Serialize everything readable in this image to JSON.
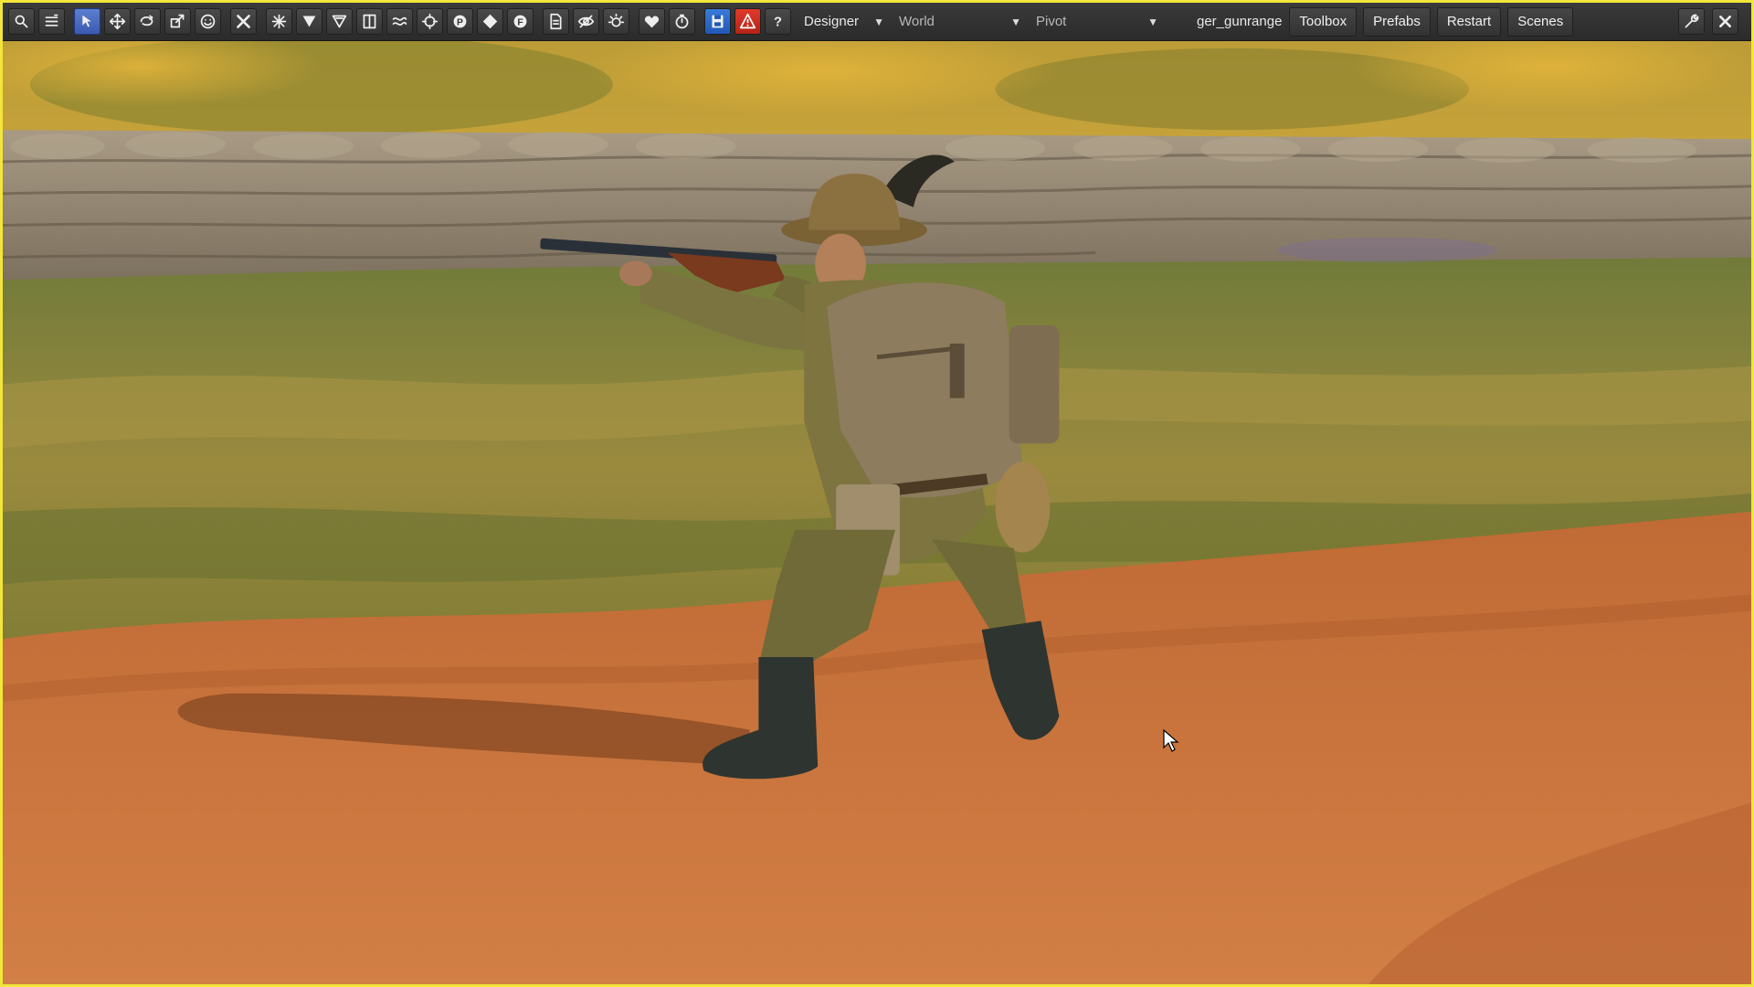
{
  "toolbar": {
    "left_icons": [
      {
        "name": "search-icon",
        "glyph": "search"
      },
      {
        "name": "menu-icon",
        "glyph": "menu"
      },
      {
        "name": "select-tool-icon",
        "glyph": "select",
        "active": true
      },
      {
        "name": "move-tool-icon",
        "glyph": "move"
      },
      {
        "name": "rotate-tool-icon",
        "glyph": "rotate"
      },
      {
        "name": "scale-tool-icon",
        "glyph": "scale"
      },
      {
        "name": "smiley-icon",
        "glyph": "smiley"
      },
      {
        "name": "close-x-icon",
        "glyph": "x"
      },
      {
        "name": "snap-icon",
        "glyph": "snap"
      },
      {
        "name": "filter-icon",
        "glyph": "filter"
      },
      {
        "name": "filter-outline-icon",
        "glyph": "filter-outline"
      },
      {
        "name": "bounds-icon",
        "glyph": "bounds"
      },
      {
        "name": "physics-icon",
        "glyph": "physics"
      },
      {
        "name": "target-icon",
        "glyph": "target"
      },
      {
        "name": "p-marker-icon",
        "glyph": "P"
      },
      {
        "name": "diamond-icon",
        "glyph": "diamond"
      },
      {
        "name": "f-marker-icon",
        "glyph": "F"
      },
      {
        "name": "document-icon",
        "glyph": "doc"
      },
      {
        "name": "eye-hidden-icon",
        "glyph": "eye"
      },
      {
        "name": "sun-icon",
        "glyph": "sun"
      },
      {
        "name": "heart-icon",
        "glyph": "heart"
      },
      {
        "name": "timer-icon",
        "glyph": "timer"
      },
      {
        "name": "save-icon",
        "glyph": "save",
        "variant": "blue"
      },
      {
        "name": "warning-icon",
        "glyph": "warning",
        "variant": "red"
      },
      {
        "name": "help-icon",
        "glyph": "?"
      }
    ],
    "mode_dropdown": "Designer",
    "space_dropdown": "World",
    "pivot_dropdown": "Pivot",
    "level_name": "ger_gunrange",
    "menu_buttons": {
      "toolbox": "Toolbox",
      "prefabs": "Prefabs",
      "restart": "Restart",
      "scenes": "Scenes"
    },
    "right_icons": [
      {
        "name": "wrench-icon",
        "glyph": "wrench"
      },
      {
        "name": "close-icon",
        "glyph": "close"
      }
    ]
  },
  "colors": {
    "frame_border": "#f2e63a",
    "toolbar_bg": "#2e2e2e",
    "dirt": "#c9733f",
    "grass": "#8a8a3a",
    "sandbags": "#9a8c78",
    "uniform": "#7d7440"
  }
}
